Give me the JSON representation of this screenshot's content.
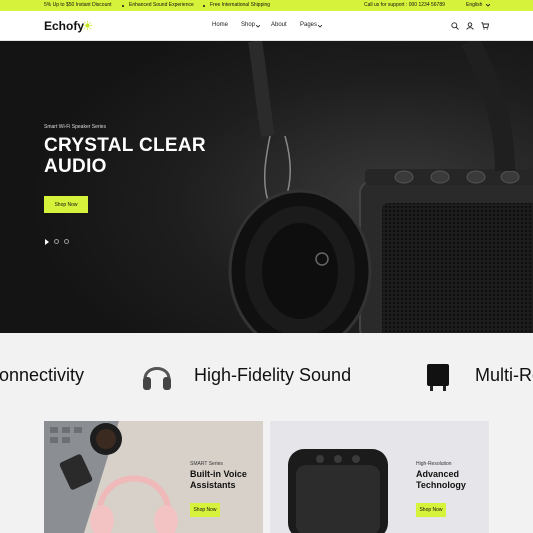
{
  "announcement": {
    "discount": "5% Up to $50 Instant Discount",
    "sound": "Enhanced Sound Experience",
    "shipping": "Free International Shipping",
    "support": "Call us for support : 000 1234 56789",
    "language": "English"
  },
  "header": {
    "logo": "Echofy",
    "nav": [
      "Home",
      "Shop",
      "About",
      "Pages"
    ]
  },
  "hero": {
    "eyebrow": "Smart Wi-Fi Speaker Series",
    "title": "CRYSTAL CLEAR AUDIO",
    "button": "Shop Now"
  },
  "marquee": {
    "items": [
      "Connectivity",
      "High-Fidelity Sound",
      "Multi-Room"
    ]
  },
  "promos": [
    {
      "eyebrow": "SMART Series",
      "title": "Built-in Voice Assistants",
      "button": "Shop Now"
    },
    {
      "eyebrow": "High-Resolution",
      "title": "Advanced Technology",
      "button": "Shop Now"
    }
  ],
  "colors": {
    "accent": "#d7f23a",
    "dark": "#1a1a1a"
  }
}
